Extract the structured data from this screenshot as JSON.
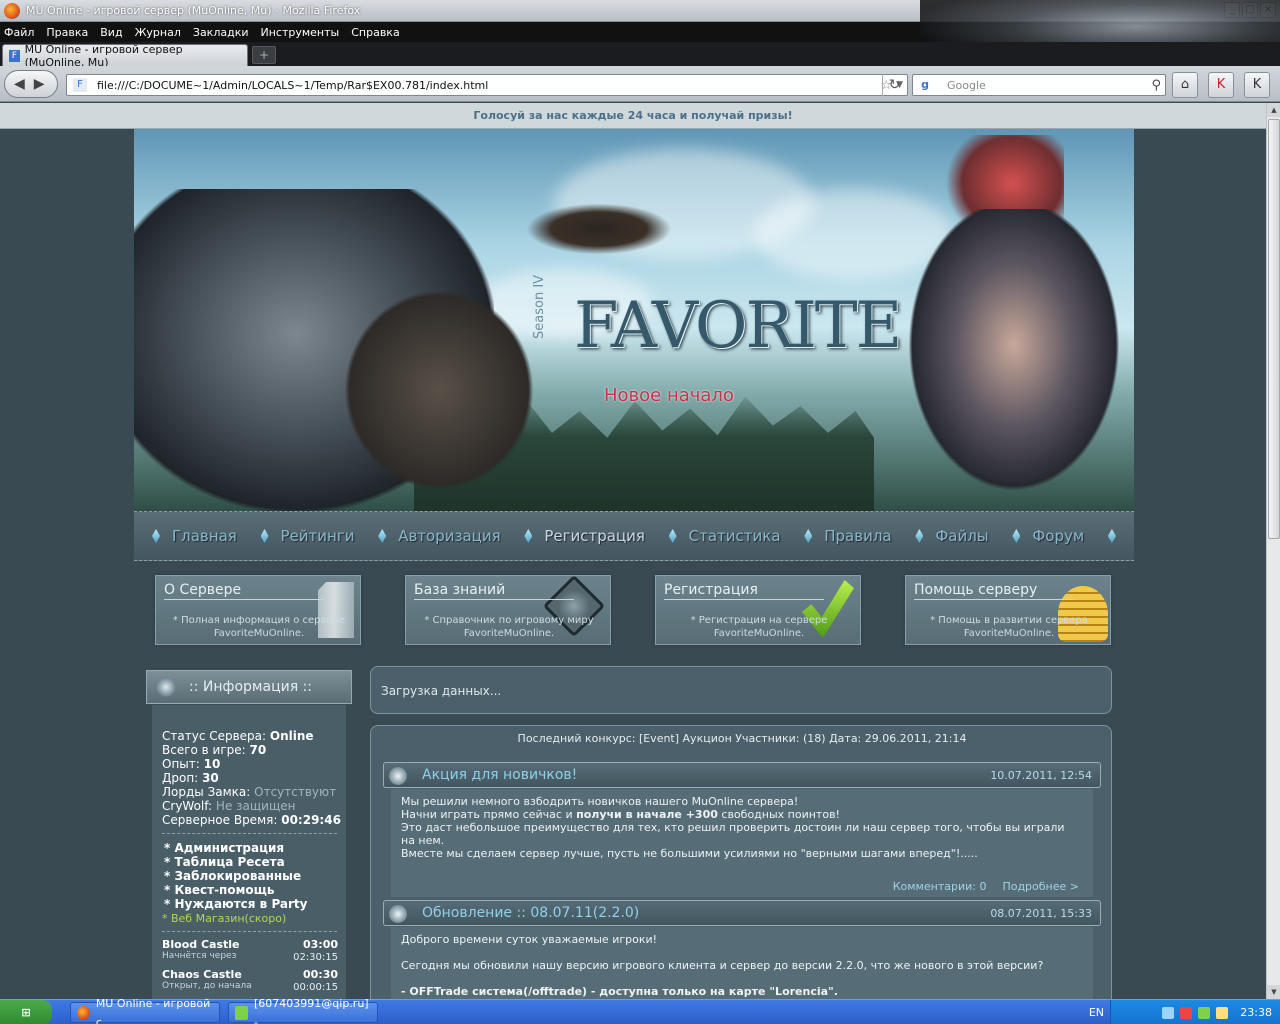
{
  "window": {
    "title": "MU Online - игровой сервер (MuOnline, Mu) - Mozilla Firefox"
  },
  "menu": [
    "Файл",
    "Правка",
    "Вид",
    "Журнал",
    "Закладки",
    "Инструменты",
    "Справка"
  ],
  "tab": {
    "label": "MU Online - игровой сервер (MuOnline, Mu)"
  },
  "nav": {
    "url": "file:///C:/DOCUME~1/Admin/LOCALS~1/Temp/Rar$EX00.781/index.html",
    "search_placeholder": "Google"
  },
  "page": {
    "vote_text": "Голосуй за нас каждые 24 часа и получай призы!",
    "logo": {
      "season": "Season IV",
      "title": "FAVORITE",
      "subtitle": "Новое начало"
    },
    "menu": [
      "Главная",
      "Рейтинги",
      "Авторизация",
      "Регистрация",
      "Статистика",
      "Правила",
      "Файлы",
      "Форум"
    ],
    "features": [
      {
        "title": "О Сервере",
        "desc1": "* Полная информация о сервере",
        "desc2": "FavoriteMuOnline.",
        "icon": "server-icon"
      },
      {
        "title": "База знаний",
        "desc1": "* Справочник по игровому миру",
        "desc2": "FavoriteMuOnline.",
        "icon": "compass-icon"
      },
      {
        "title": "Регистрация",
        "desc1": "* Регистрация на сервере",
        "desc2": "FavoriteMuOnline.",
        "icon": "checkmark-icon"
      },
      {
        "title": "Помощь серверу",
        "desc1": "* Помощь в развитии сервера",
        "desc2": "FavoriteMuOnline.",
        "icon": "coins-icon"
      }
    ],
    "sidebar": {
      "header": ":: Информация ::",
      "status_label": "Статус Сервера:",
      "status_value": "Online",
      "total_label": "Всего в игре:",
      "total_value": "70",
      "exp_label": "Опыт:",
      "exp_value": "10",
      "drop_label": "Дроп:",
      "drop_value": "30",
      "lords_label": "Лорды Замка:",
      "lords_value": "Отсутствуют",
      "crywolf_label": "CryWolf:",
      "crywolf_value": "Не защищен",
      "time_label": "Серверное Время:",
      "time_value": "00:29:46",
      "links": [
        "* Администрация",
        "* Таблица Ресета",
        "* Заблокированные",
        "* Квест-помощь",
        "* Нуждаются в Party"
      ],
      "shop": "* Веб Магазин(скоро)",
      "events": [
        {
          "name": "Blood Castle",
          "time": "03:00",
          "sub": "Начнётся через",
          "subtime": "02:30:15"
        },
        {
          "name": "Chaos Castle",
          "time": "00:30",
          "sub": "Открыт, до начала",
          "subtime": "00:00:15"
        }
      ]
    },
    "loading": "Загрузка данных...",
    "last_contest": "Последний конкурс: [Event] Аукцион Участники: (18) Дата: 29.06.2011, 21:14",
    "news": [
      {
        "title": "Акция для новичков!",
        "date": "10.07.2011, 12:54",
        "l1": "Мы решили немного взбодрить новичков нашего MuOnline сервера!",
        "l2a": "Начни играть прямо сейчас и ",
        "l2b": "получи в начале +300",
        "l2c": " свободных поинтов!",
        "l3": "Это даст небольшое преимущество для тех, кто решил проверить достоин ли наш сервер того, чтобы вы играли",
        "l4": "на нем.",
        "l5": "Вместе мы сделаем сервер лучше, пусть не большими усилиями но \"верными шагами вперед\"!.....",
        "comments": "Комментарии: 0",
        "more": "Подробнее >"
      },
      {
        "title": "Обновление :: 08.07.11(2.2.0)",
        "date": "08.07.2011, 15:33",
        "l1": "Доброго времени суток уважаемые игроки!",
        "l2": "Сегодня мы обновили нашу версию игрового клиента и сервер до версии 2.2.0, что же нового в этой версии?",
        "l3": "- OFFTrade система(/offtrade) - доступна только на карте \"Lorencia\"."
      }
    ]
  },
  "taskbar": {
    "items": [
      "MU Online - игровой с...",
      "[607403991@qip.ru] -..."
    ],
    "lang": "EN",
    "clock": "23:38"
  }
}
